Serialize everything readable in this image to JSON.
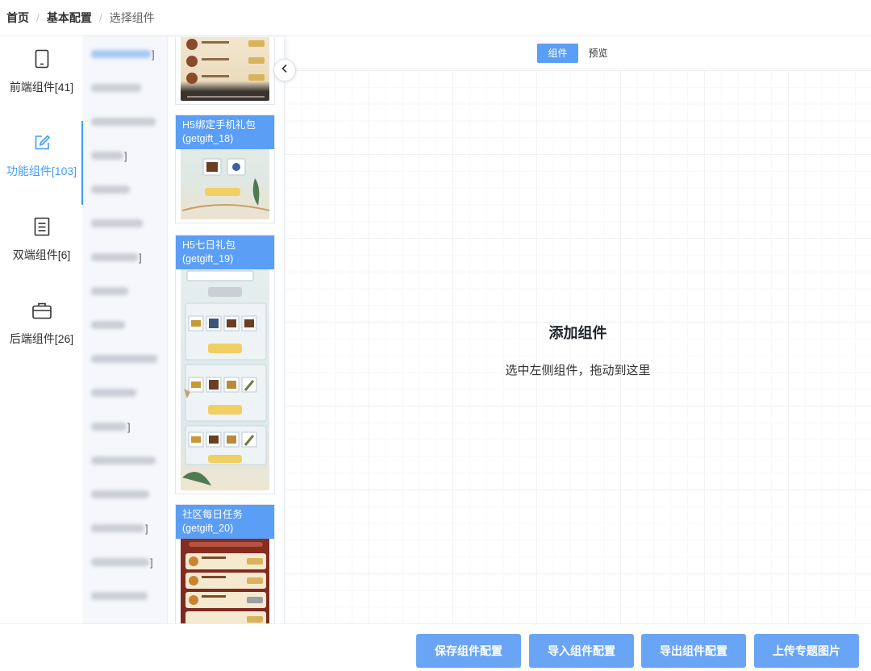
{
  "breadcrumb": {
    "home": "首页",
    "config": "基本配置",
    "current": "选择组件"
  },
  "categories": [
    {
      "label": "前端组件[41]",
      "icon": "tablet-icon"
    },
    {
      "label": "功能组件[103]",
      "icon": "edit-icon"
    },
    {
      "label": "双端组件[6]",
      "icon": "document-icon"
    },
    {
      "label": "后端组件[26]",
      "icon": "briefcase-icon"
    }
  ],
  "thumbnails": [
    {
      "caption": ""
    },
    {
      "caption": "H5绑定手机礼包 (getgift_18)"
    },
    {
      "caption": "H5七日礼包 (getgift_19)"
    },
    {
      "caption": "社区每日任务 (getgift_20)"
    }
  ],
  "tabs": {
    "component": "组件",
    "preview": "预览"
  },
  "canvas": {
    "empty_title": "添加组件",
    "empty_hint": "选中左侧组件，拖动到这里"
  },
  "footer": {
    "save": "保存组件配置",
    "import": "导入组件配置",
    "export": "导出组件配置",
    "upload": "上传专题图片"
  },
  "colors": {
    "accent": "#409eff",
    "button": "#6aa5f5",
    "tab_active": "#5b9ef5"
  }
}
